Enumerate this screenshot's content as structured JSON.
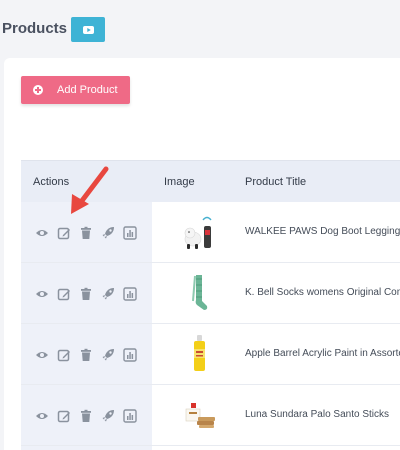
{
  "header": {
    "title": "Products",
    "video_button_icon": "youtube-play-icon"
  },
  "toolbar": {
    "add_product_label": "Add Product",
    "add_product_icon": "plus-circle-icon"
  },
  "table": {
    "columns": [
      "Actions",
      "Image",
      "Product Title"
    ],
    "action_icons": [
      "eye-icon",
      "edit-icon",
      "trash-icon",
      "rocket-icon",
      "chart-icon"
    ],
    "rows": [
      {
        "image": "dog-boots-product-image",
        "title": "WALKEE PAWS Dog Boot Leggings"
      },
      {
        "image": "green-socks-product-image",
        "title": "K. Bell Socks womens Original Compression"
      },
      {
        "image": "acrylic-paint-product-image",
        "title": "Apple Barrel Acrylic Paint in Assorted"
      },
      {
        "image": "palo-santo-product-image",
        "title": "Luna Sundara Palo Santo Sticks"
      }
    ]
  },
  "annotation": {
    "arrow_color": "#e8473f"
  },
  "colors": {
    "accent_pink": "#ef6a86",
    "accent_blue": "#3eb3d5",
    "icon_gray": "#8a929e"
  }
}
